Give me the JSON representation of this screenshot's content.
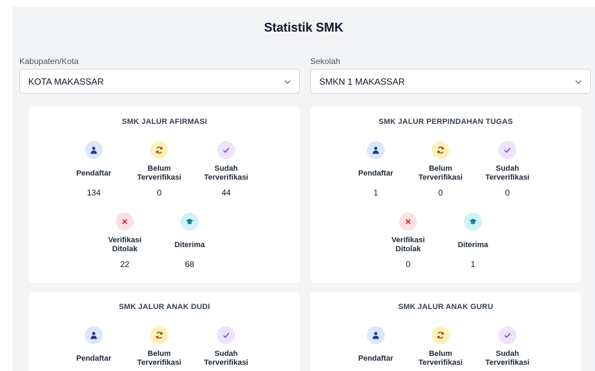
{
  "page": {
    "title": "Statistik SMK"
  },
  "filters": {
    "kabupaten": {
      "label": "Kabupaten/Kota",
      "value": "KOTA MAKASSAR"
    },
    "sekolah": {
      "label": "Sekolah",
      "value": "SMKN 1 MAKASSAR"
    }
  },
  "stat_labels": {
    "pendaftar": "Pendaftar",
    "belum_1": "Belum",
    "belum_2": "Terverifikasi",
    "sudah_1": "Sudah",
    "sudah_2": "Terverifikasi",
    "ditolak_1": "Verifikasi",
    "ditolak_2": "Ditolak",
    "diterima": "Diterima"
  },
  "icons": {
    "pendaftar": "user-icon",
    "belum": "refresh-icon",
    "sudah": "check-icon",
    "ditolak": "close-icon",
    "diterima": "graduation-cap-icon"
  },
  "colors": {
    "blue_bg": "#dbe7fb",
    "yellow_bg": "#fdf1b8",
    "purple_bg": "#ede4fb",
    "red_bg": "#fbe1e4",
    "cyan_bg": "#cdf3f6"
  },
  "cards": [
    {
      "title": "SMK JALUR AFIRMASI",
      "pendaftar": "134",
      "belum": "0",
      "sudah": "44",
      "ditolak": "22",
      "diterima": "68"
    },
    {
      "title": "SMK JALUR PERPINDAHAN TUGAS",
      "pendaftar": "1",
      "belum": "0",
      "sudah": "0",
      "ditolak": "0",
      "diterima": "1"
    },
    {
      "title": "SMK JALUR ANAK DUDI"
    },
    {
      "title": "SMK JALUR ANAK GURU"
    }
  ]
}
